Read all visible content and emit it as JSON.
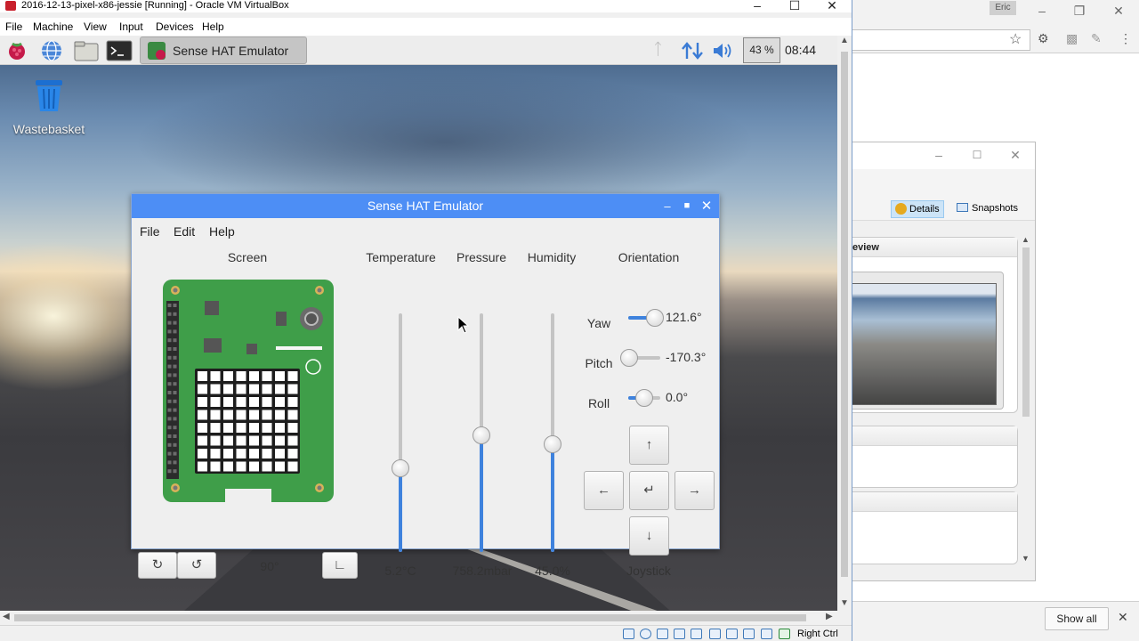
{
  "vbox": {
    "title": "2016-12-13-pixel-x86-jessie [Running] - Oracle VM VirtualBox",
    "menu": [
      "File",
      "Machine",
      "View",
      "Input",
      "Devices",
      "Help"
    ],
    "status_right": "Right Ctrl"
  },
  "panel": {
    "task_label": "Sense HAT Emulator",
    "cpu": "43 %",
    "clock": "08:44"
  },
  "desktop": {
    "wastebasket_label": "Wastebasket"
  },
  "emulator": {
    "title": "Sense HAT Emulator",
    "menu": [
      "File",
      "Edit",
      "Help"
    ],
    "sections": {
      "screen": "Screen",
      "temperature": "Temperature",
      "pressure": "Pressure",
      "humidity": "Humidity",
      "orientation": "Orientation",
      "joystick": "Joystick"
    },
    "screen_rotation": "90°",
    "rotate_cw_icon": "↻",
    "rotate_ccw_icon": "↺",
    "orient_icon": "∟",
    "sensors": {
      "temperature": {
        "text": "5.2°C",
        "level": 0.35
      },
      "pressure": {
        "text": "758.2mbar",
        "level": 0.49
      },
      "humidity": {
        "text": "45.0%",
        "level": 0.45
      }
    },
    "orientation": {
      "yaw": {
        "label": "Yaw",
        "text": "121.6°",
        "level": 0.84
      },
      "pitch": {
        "label": "Pitch",
        "text": "-170.3°",
        "level": 0.03
      },
      "roll": {
        "label": "Roll",
        "text": "0.0°",
        "level": 0.5
      }
    },
    "joystick": {
      "up": "↑",
      "left": "←",
      "enter": "↵",
      "right": "→",
      "down": "↓"
    }
  },
  "browser": {
    "user_badge": "Eric",
    "show_all": "Show all",
    "vbm": {
      "details": "Details",
      "snapshots": "Snapshots",
      "preview_head": "eview"
    }
  },
  "colors": {
    "emu_titlebar": "#4d8ef5",
    "slider_fill": "#3e82dd",
    "board_green": "#3f9e49"
  }
}
